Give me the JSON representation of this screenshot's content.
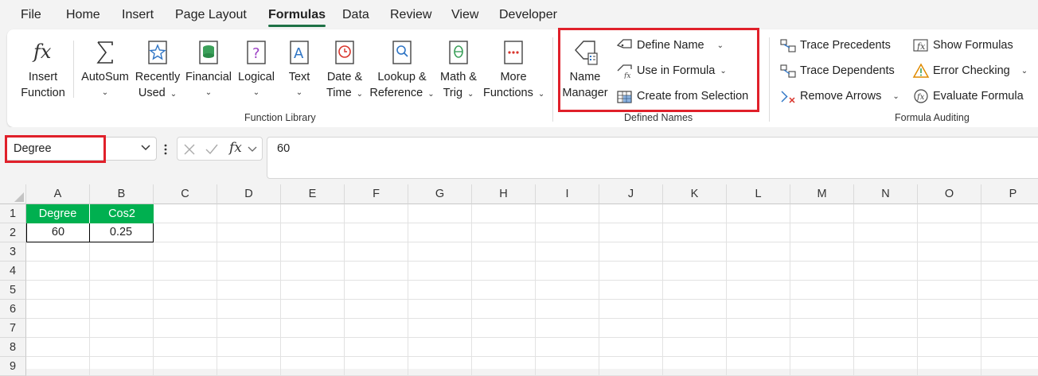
{
  "menu": [
    "File",
    "Home",
    "Insert",
    "Page Layout",
    "Formulas",
    "Data",
    "Review",
    "View",
    "Developer"
  ],
  "active_tab": "Formulas",
  "ribbon": {
    "function_library": {
      "insert_function": [
        "Insert",
        "Function"
      ],
      "autosum": "AutoSum",
      "recently_used": [
        "Recently",
        "Used"
      ],
      "financial": "Financial",
      "logical": "Logical",
      "text": "Text",
      "date_time": [
        "Date &",
        "Time"
      ],
      "lookup": [
        "Lookup &",
        "Reference"
      ],
      "math": [
        "Math &",
        "Trig"
      ],
      "more": [
        "More",
        "Functions"
      ],
      "label": "Function Library"
    },
    "defined_names": {
      "name_manager": [
        "Name",
        "Manager"
      ],
      "define_name": "Define Name",
      "use_in_formula": "Use in Formula",
      "create_from_selection": "Create from Selection",
      "label": "Defined Names"
    },
    "formula_auditing": {
      "trace_precedents": "Trace Precedents",
      "trace_dependents": "Trace Dependents",
      "remove_arrows": "Remove Arrows",
      "show_formulas": "Show Formulas",
      "error_checking": "Error Checking",
      "evaluate_formula": "Evaluate Formula",
      "label": "Formula Auditing"
    }
  },
  "formula_bar": {
    "name_box": "Degree",
    "fx": "fx",
    "formula": "60"
  },
  "sheet": {
    "columns": [
      "A",
      "B",
      "C",
      "D",
      "E",
      "F",
      "G",
      "H",
      "I",
      "J",
      "K",
      "L",
      "M",
      "N",
      "O",
      "P"
    ],
    "rows": [
      "1",
      "2",
      "3",
      "4",
      "5",
      "6",
      "7",
      "8",
      "9"
    ],
    "cells": {
      "A1": "Degree",
      "B1": "Cos2",
      "A2": "60",
      "B2": "0.25"
    }
  },
  "colors": {
    "header_fill": "#00b050",
    "highlight": "#e0202a",
    "active_underline": "#1e7145"
  }
}
